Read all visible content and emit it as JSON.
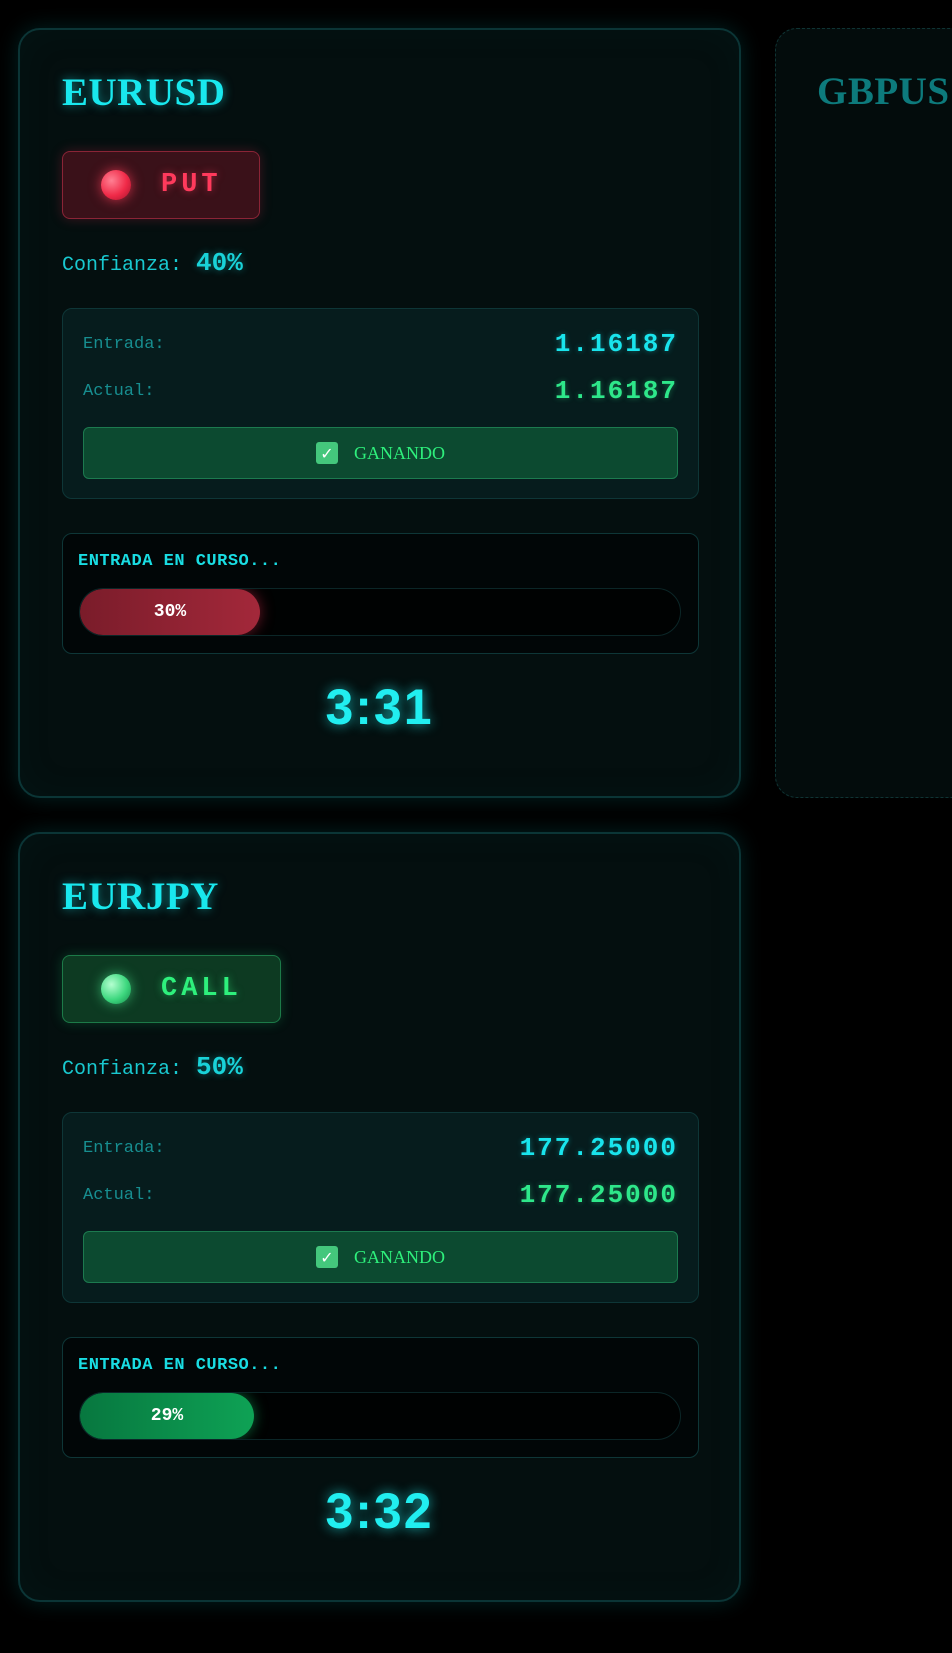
{
  "cards": [
    {
      "pair": "EURUSD",
      "signal": "PUT",
      "confidence_label": "Confianza:",
      "confidence_value": "40%",
      "entry_label": "Entrada:",
      "entry_value": "1.16187",
      "actual_label": "Actual:",
      "actual_value": "1.16187",
      "status": "GANANDO",
      "progress_label": "ENTRADA EN CURSO...",
      "progress_text": "30%",
      "progress": 0.3,
      "timer": "3:31"
    },
    {
      "pair": "GBPUS"
    },
    {
      "pair": "EURJPY",
      "signal": "CALL",
      "confidence_label": "Confianza:",
      "confidence_value": "50%",
      "entry_label": "Entrada:",
      "entry_value": "177.25000",
      "actual_label": "Actual:",
      "actual_value": "177.25000",
      "status": "GANANDO",
      "progress_label": "ENTRADA EN CURSO...",
      "progress_text": "29%",
      "progress": 0.29,
      "timer": "3:32"
    }
  ],
  "colors": {
    "put": "#ff3a5c",
    "call": "#2ef07c",
    "accent": "#19e8ee",
    "background": "#000000"
  },
  "icons": {
    "status": "checkbox-checked-icon",
    "signal_indicator": "status-dot-icon"
  }
}
